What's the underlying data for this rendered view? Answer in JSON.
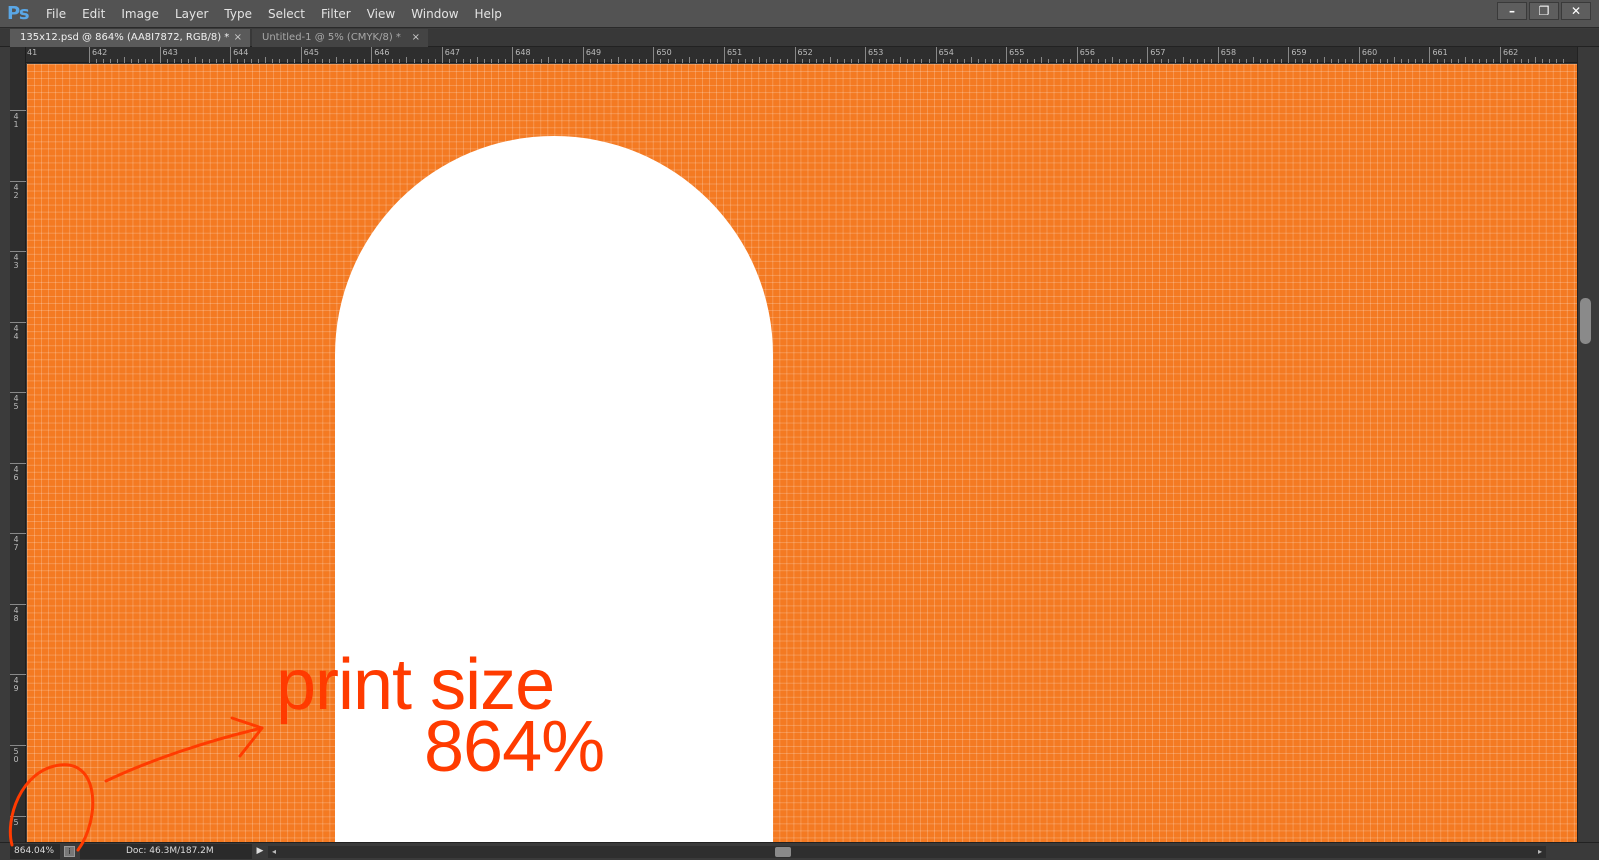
{
  "app": {
    "logo": "Ps"
  },
  "menu": [
    "File",
    "Edit",
    "Image",
    "Layer",
    "Type",
    "Select",
    "Filter",
    "View",
    "Window",
    "Help"
  ],
  "window_controls": {
    "minimize": "–",
    "restore": "❐",
    "close": "✕"
  },
  "tabs": [
    {
      "label": "135x12.psd @ 864% (AA8I7872, RGB/8) *",
      "close": "×",
      "active": true
    },
    {
      "label": "Untitled-1 @ 5% (CMYK/8) *",
      "close": "×",
      "active": false
    }
  ],
  "ruler_top": {
    "start_label": "41",
    "labels": [
      "642",
      "643",
      "644",
      "645",
      "646",
      "647",
      "648",
      "649",
      "650",
      "651",
      "652",
      "653",
      "654",
      "655",
      "656",
      "657",
      "658",
      "659",
      "660",
      "661",
      "662"
    ]
  },
  "ruler_left": {
    "labels": [
      "41",
      "42",
      "43",
      "44",
      "45",
      "46",
      "47",
      "48",
      "49",
      "50",
      "5"
    ]
  },
  "annotation": {
    "line1": "print size",
    "line2": "864%",
    "color": "#ff3b00"
  },
  "canvas": {
    "fill": "#f47a22",
    "shape_fill": "#ffffff"
  },
  "status": {
    "zoom": "864.04%",
    "doc": "Doc: 46.3M/187.2M",
    "arrow": "▶",
    "scroll_left": "◂",
    "scroll_right": "▸"
  }
}
